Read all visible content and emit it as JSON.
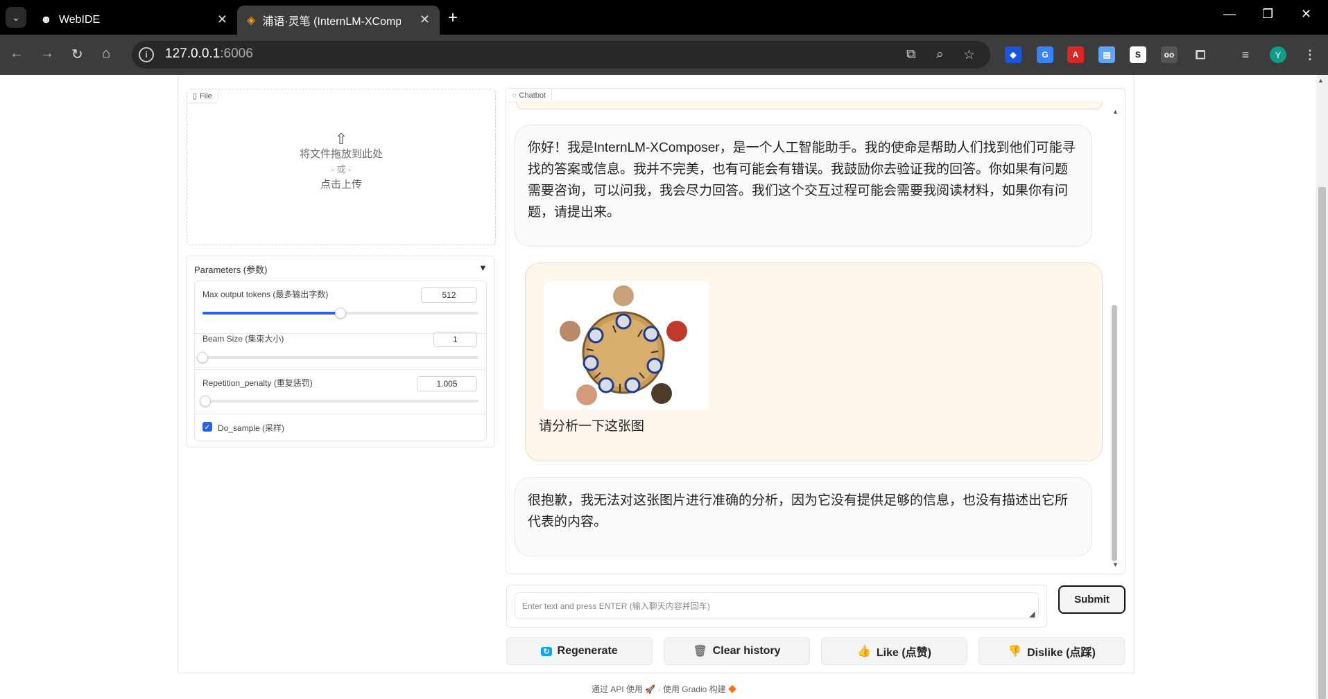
{
  "browser": {
    "tabs": [
      {
        "label": "WebIDE",
        "icon": "bot-icon"
      },
      {
        "label": "浦语·灵笔 (InternLM-XCompo",
        "icon": "layers-icon"
      }
    ],
    "url_host": "127.0.0.1",
    "url_port": ":6006",
    "profile_initial": "Y"
  },
  "file": {
    "label": "File",
    "drop_text": "将文件拖放到此处",
    "or_text": "- 或 -",
    "click_text": "点击上传"
  },
  "params": {
    "title": "Parameters (参数)",
    "toggle": "▼",
    "max_tokens": {
      "label": "Max output tokens (最多输出字数)",
      "value": "512",
      "fraction": 0.5
    },
    "beam_size": {
      "label": "Beam Size (集束大小)",
      "value": "1",
      "fraction": 0.0
    },
    "repetition": {
      "label": "Repetition_penalty (重复惩罚)",
      "value": "1.005",
      "fraction": 0.01
    },
    "do_sample": {
      "label": "Do_sample (采样)",
      "checked": true
    }
  },
  "chat": {
    "label": "Chatbot",
    "messages": [
      {
        "role": "bot",
        "text": "你好！我是InternLM-XComposer，是一个人工智能助手。我的使命是帮助人们找到他们可能寻找的答案或信息。我并不完美，也有可能会有错误。我鼓励你去验证我的回答。你如果有问题需要咨询，可以问我，我会尽力回答。我们这个交互过程可能会需要我阅读材料，如果你有问题，请提出来。"
      },
      {
        "role": "user",
        "text": "请分析一下这张图"
      },
      {
        "role": "bot",
        "text": "很抱歉，我无法对这张图片进行准确的分析，因为它没有提供足够的信息，也没有描述出它所代表的内容。"
      }
    ]
  },
  "input": {
    "placeholder": "Enter text and press ENTER (输入聊天内容并回车)",
    "submit_label": "Submit"
  },
  "actions": {
    "regenerate": "Regenerate",
    "clear": "Clear history",
    "like": "Like (点赞)",
    "dislike": "Dislike (点踩)"
  },
  "footer": {
    "api": "通过 API 使用",
    "dot": "·",
    "built": "使用 Gradio 构建"
  }
}
